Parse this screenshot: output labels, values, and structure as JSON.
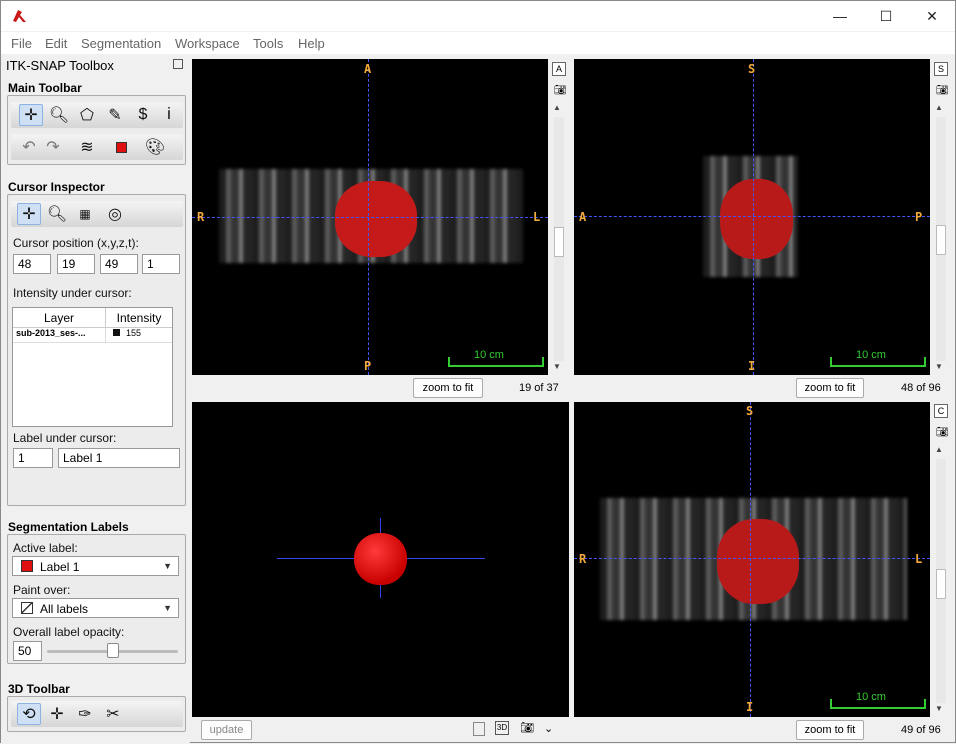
{
  "window": {
    "minimize": "—",
    "maximize": "☐",
    "close": "✕"
  },
  "menu": [
    "File",
    "Edit",
    "Segmentation",
    "Workspace",
    "Tools",
    "Help"
  ],
  "toolbox": {
    "title": "ITK-SNAP Toolbox",
    "main_toolbar": "Main Toolbar",
    "cursor_inspector": "Cursor Inspector",
    "cursor_position_label": "Cursor position (x,y,z,t):",
    "cursor_position": [
      "48",
      "19",
      "49",
      "1"
    ],
    "intensity_label": "Intensity under cursor:",
    "table_headers": [
      "Layer",
      "Intensity"
    ],
    "table_rows": [
      {
        "layer": "sub-2013_ses-...",
        "intensity": "155"
      }
    ],
    "label_under_cursor_label": "Label under cursor:",
    "label_id": "1",
    "label_name": "Label 1",
    "segmentation_labels": "Segmentation Labels",
    "active_label_label": "Active label:",
    "active_label": "Label 1",
    "paint_over_label": "Paint over:",
    "paint_over": "All labels",
    "opacity_label": "Overall label opacity:",
    "opacity_value": "50",
    "opacity_fraction": 0.5,
    "toolbar_3d": "3D Toolbar"
  },
  "colors": {
    "label1": "#e01010",
    "crosshair": "#4455ff",
    "orientation": "#f2a93b",
    "scalebar": "#33cc33"
  },
  "views": {
    "axial": {
      "top": "A",
      "bottom": "P",
      "left": "R",
      "right": "L",
      "scale": "10 cm",
      "zoom": "zoom to fit",
      "slice": "19 of 37",
      "side_btn": "A"
    },
    "sagittal": {
      "top": "S",
      "bottom": "I",
      "left": "A",
      "right": "P",
      "scale": "10 cm",
      "zoom": "zoom to fit",
      "slice": "48 of 96",
      "side_btn": "S"
    },
    "view3d": {
      "update": "update",
      "mode": "3D"
    },
    "coronal": {
      "top": "S",
      "bottom": "I",
      "left": "R",
      "right": "L",
      "scale": "10 cm",
      "zoom": "zoom to fit",
      "slice": "49 of 96",
      "side_btn": "C"
    }
  }
}
